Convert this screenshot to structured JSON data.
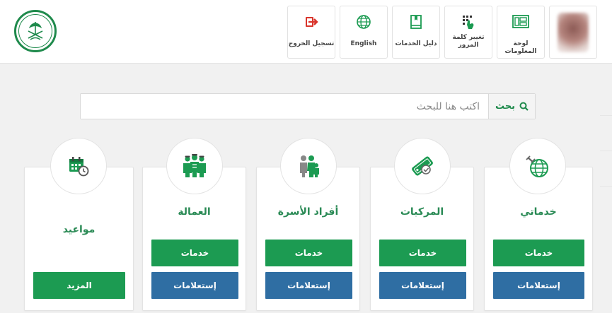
{
  "header": {
    "toolbar": [
      {
        "id": "dashboard",
        "label": "لوحة المعلومات",
        "icon": "dashboard-icon"
      },
      {
        "id": "change-password",
        "label": "تغيير كلمة المرور",
        "icon": "keypad-icon"
      },
      {
        "id": "services-guide",
        "label": "دليل الخدمات",
        "icon": "book-icon"
      },
      {
        "id": "english",
        "label": "English",
        "icon": "globe-icon"
      },
      {
        "id": "logout",
        "label": "تسجيل الخروج",
        "icon": "logout-icon"
      }
    ]
  },
  "search": {
    "button_label": "بحث",
    "placeholder": "اكتب هنا للبحث"
  },
  "cards": [
    {
      "id": "my-services",
      "title": "خدماتي",
      "icon": "globe-satellite-icon",
      "buttons": [
        "خدمات",
        "إستعلامات"
      ]
    },
    {
      "id": "vehicles",
      "title": "المركبات",
      "icon": "vehicle-tag-icon",
      "buttons": [
        "خدمات",
        "إستعلامات"
      ]
    },
    {
      "id": "family",
      "title": "أفراد الأسرة",
      "icon": "family-icon",
      "buttons": [
        "خدمات",
        "إستعلامات"
      ]
    },
    {
      "id": "labor",
      "title": "العمالة",
      "icon": "workers-icon",
      "buttons": [
        "خدمات",
        "إستعلامات"
      ]
    },
    {
      "id": "appointments",
      "title": "مواعيد",
      "icon": "calendar-clock-icon",
      "buttons": [
        "المزيد"
      ]
    }
  ],
  "colors": {
    "brand_green": "#1c9b52",
    "title_green": "#2a8a55",
    "inquiry_blue": "#2f6ea3",
    "logout_red": "#d9342b"
  }
}
